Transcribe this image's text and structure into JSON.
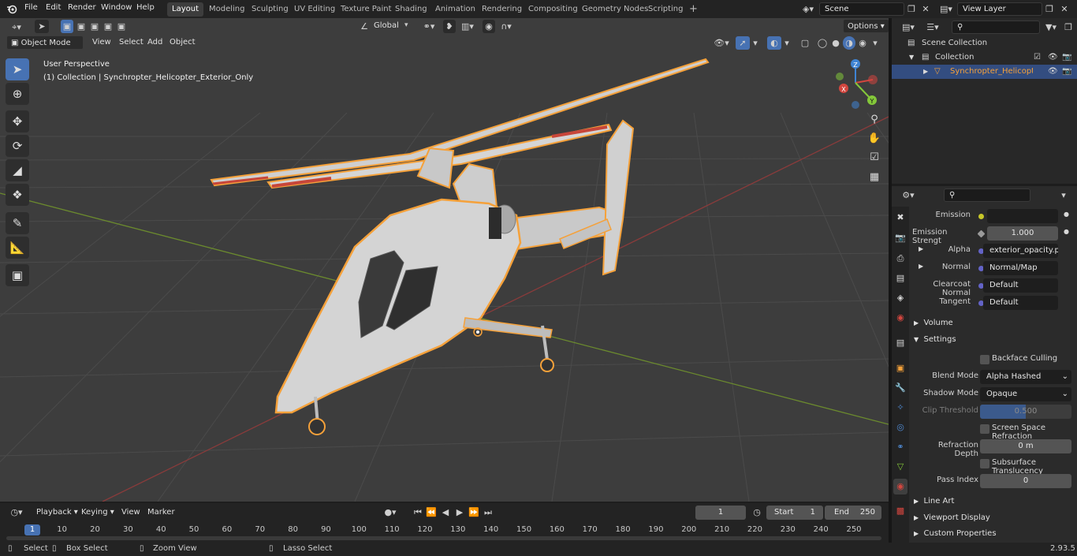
{
  "topbar": {
    "menus": [
      "File",
      "Edit",
      "Render",
      "Window",
      "Help"
    ],
    "workspaces": [
      "Layout",
      "Modeling",
      "Sculpting",
      "UV Editing",
      "Texture Paint",
      "Shading",
      "Animation",
      "Rendering",
      "Compositing",
      "Geometry Nodes",
      "Scripting"
    ],
    "active_workspace": "Layout",
    "add_workspace": "+",
    "scene": "Scene",
    "view_layer": "View Layer"
  },
  "viewport": {
    "mode": "Object Mode",
    "menus": [
      "View",
      "Select",
      "Add",
      "Object"
    ],
    "transform_orientation": "Global",
    "options": "Options",
    "overlay_title": "User Perspective",
    "overlay_subtitle": "(1) Collection | Synchropter_Helicopter_Exterior_Only",
    "gizmo": {
      "x": "X",
      "y": "Y",
      "z": "Z"
    }
  },
  "outliner": {
    "rows": [
      {
        "label": "Scene Collection"
      },
      {
        "label": "Collection"
      },
      {
        "label": "Synchropter_Helicopter_E"
      }
    ]
  },
  "properties": {
    "rows": [
      {
        "label": "Emission",
        "value": ""
      },
      {
        "label": "Emission Strengt",
        "value": "1.000"
      },
      {
        "label": "Alpha",
        "value": "exterior_opacity.png"
      },
      {
        "label": "Normal",
        "value": "Normal/Map"
      },
      {
        "label": "Clearcoat Normal",
        "value": "Default"
      },
      {
        "label": "Tangent",
        "value": "Default"
      }
    ],
    "sections": {
      "volume": "Volume",
      "settings": "Settings",
      "line_art": "Line Art",
      "viewport_display": "Viewport Display",
      "custom_properties": "Custom Properties"
    },
    "settings": {
      "backface_culling": "Backface Culling",
      "blend_mode_label": "Blend Mode",
      "blend_mode": "Alpha Hashed",
      "shadow_mode_label": "Shadow Mode",
      "shadow_mode": "Opaque",
      "clip_threshold_label": "Clip Threshold",
      "clip_threshold": "0.500",
      "screen_space_refraction": "Screen Space Refraction",
      "refraction_depth_label": "Refraction Depth",
      "refraction_depth": "0 m",
      "subsurface_translucency": "Subsurface Translucency",
      "pass_index_label": "Pass Index",
      "pass_index": "0"
    }
  },
  "timeline": {
    "menus": [
      "Playback",
      "Keying",
      "View",
      "Marker"
    ],
    "current_frame": "1",
    "start_label": "Start",
    "start": "1",
    "end_label": "End",
    "end": "250",
    "ruler": [
      "1",
      "10",
      "20",
      "30",
      "40",
      "50",
      "60",
      "70",
      "80",
      "90",
      "100",
      "110",
      "120",
      "130",
      "140",
      "150",
      "160",
      "170",
      "180",
      "190",
      "200",
      "210",
      "220",
      "230",
      "240",
      "250"
    ]
  },
  "statusbar": {
    "items": [
      "Select",
      "Box Select",
      "Zoom View",
      "Lasso Select"
    ],
    "version": "2.93.5"
  },
  "colors": {
    "accent": "#4772b3",
    "selection_outline": "#f5a13a",
    "x_axis": "#d3463f",
    "y_axis": "#84c83a",
    "z_axis": "#3f84d3"
  }
}
